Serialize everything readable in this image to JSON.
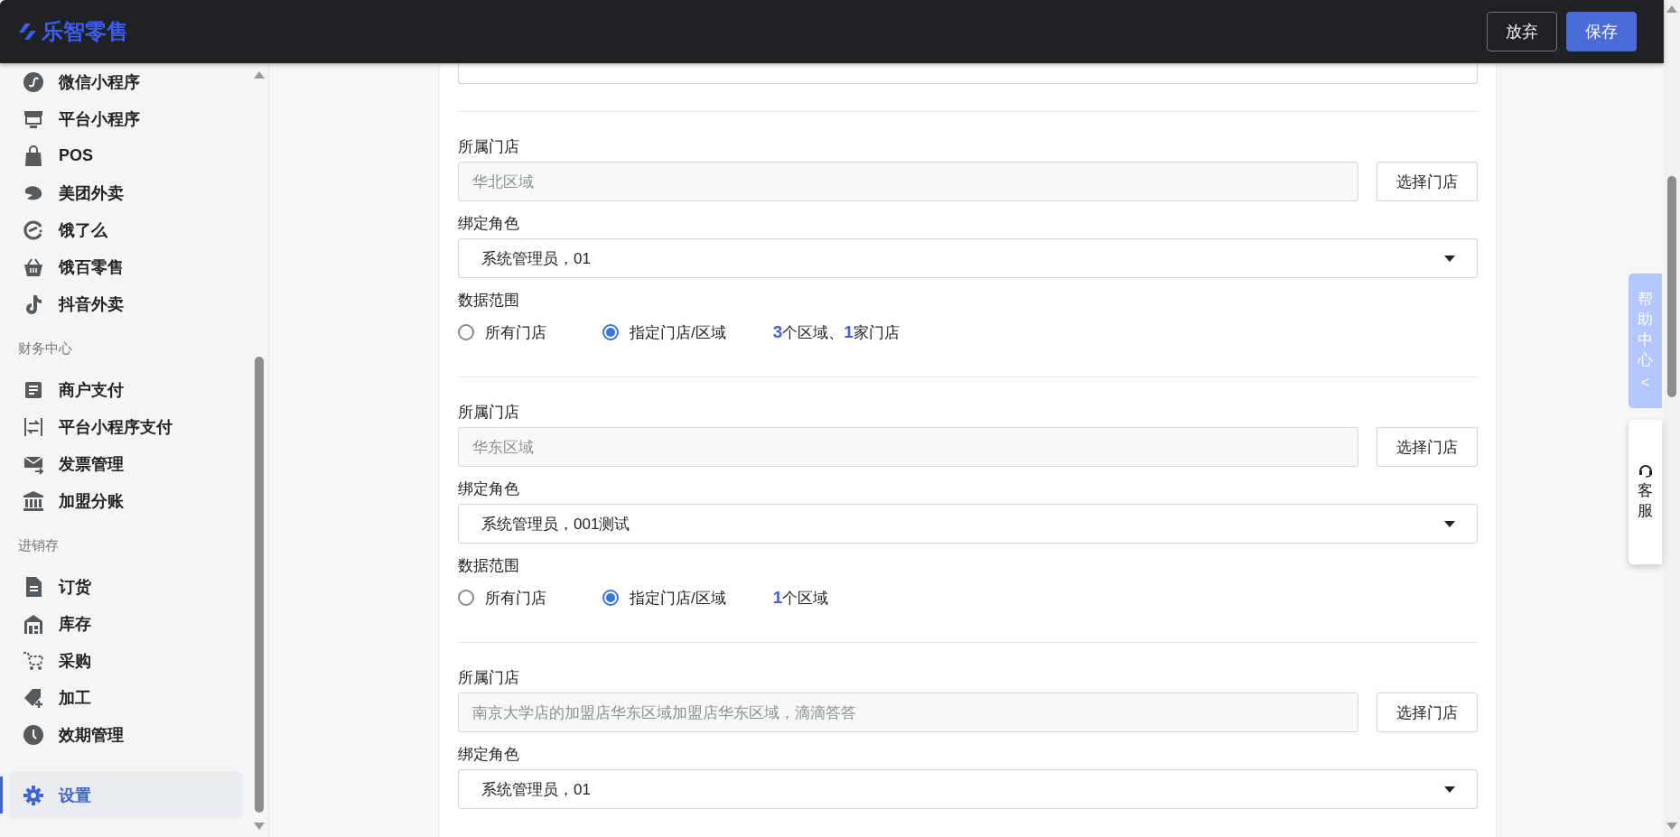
{
  "header": {
    "logo": "乐智零售",
    "buttons": [
      {
        "label": "放弃",
        "kind": "outline"
      },
      {
        "label": "保存",
        "kind": "primary"
      }
    ]
  },
  "sidebar": {
    "groups": [
      {
        "items": [
          {
            "label": "微信小程序",
            "selected": false
          },
          {
            "label": "平台小程序",
            "selected": false
          },
          {
            "label": "POS",
            "selected": false
          },
          {
            "label": "美团外卖",
            "selected": false
          },
          {
            "label": "饿了么",
            "selected": false
          },
          {
            "label": "饿百零售",
            "selected": false
          },
          {
            "label": "抖音外卖",
            "selected": false
          }
        ]
      },
      {
        "title": "财务中心",
        "items": [
          {
            "label": "商户支付",
            "selected": false
          },
          {
            "label": "平台小程序支付",
            "selected": false
          },
          {
            "label": "发票管理",
            "selected": false
          },
          {
            "label": "加盟分账",
            "selected": false
          }
        ]
      },
      {
        "title": "进销存",
        "items": [
          {
            "label": "订货",
            "selected": false
          },
          {
            "label": "库存",
            "selected": false
          },
          {
            "label": "采购",
            "selected": false
          },
          {
            "label": "加工",
            "selected": false
          },
          {
            "label": "效期管理",
            "selected": false
          }
        ]
      },
      {
        "items": [
          {
            "label": "设置",
            "selected": true
          }
        ]
      }
    ]
  },
  "form": {
    "assignments": [
      {
        "store_label": "所属门店",
        "store_value": "华北区域",
        "store_button": "选择门店",
        "role_label": "绑定角色",
        "role_value": "系统管理员，01",
        "scope_label": "数据范围",
        "scope_options": [
          {
            "label": "所有门店",
            "selected": false
          },
          {
            "label": "指定门店/区域",
            "selected": true
          }
        ],
        "scope_summary": "**3**个区域、**1**家门店"
      },
      {
        "store_label": "所属门店",
        "store_value": "华东区域",
        "store_button": "选择门店",
        "role_label": "绑定角色",
        "role_value": "系统管理员，001测试",
        "scope_label": "数据范围",
        "scope_options": [
          {
            "label": "所有门店",
            "selected": false
          },
          {
            "label": "指定门店/区域",
            "selected": true
          }
        ],
        "scope_summary": "**1**个区域"
      },
      {
        "store_label": "所属门店",
        "store_value": "南京大学店的加盟店华东区域加盟店华东区域，滴滴答答",
        "store_button": "选择门店",
        "role_label": "绑定角色",
        "role_value": "系统管理员，01"
      }
    ]
  },
  "help_tab": {
    "text": "帮助中心",
    "arrow": "<"
  },
  "service_tab": {
    "text": "客服"
  }
}
